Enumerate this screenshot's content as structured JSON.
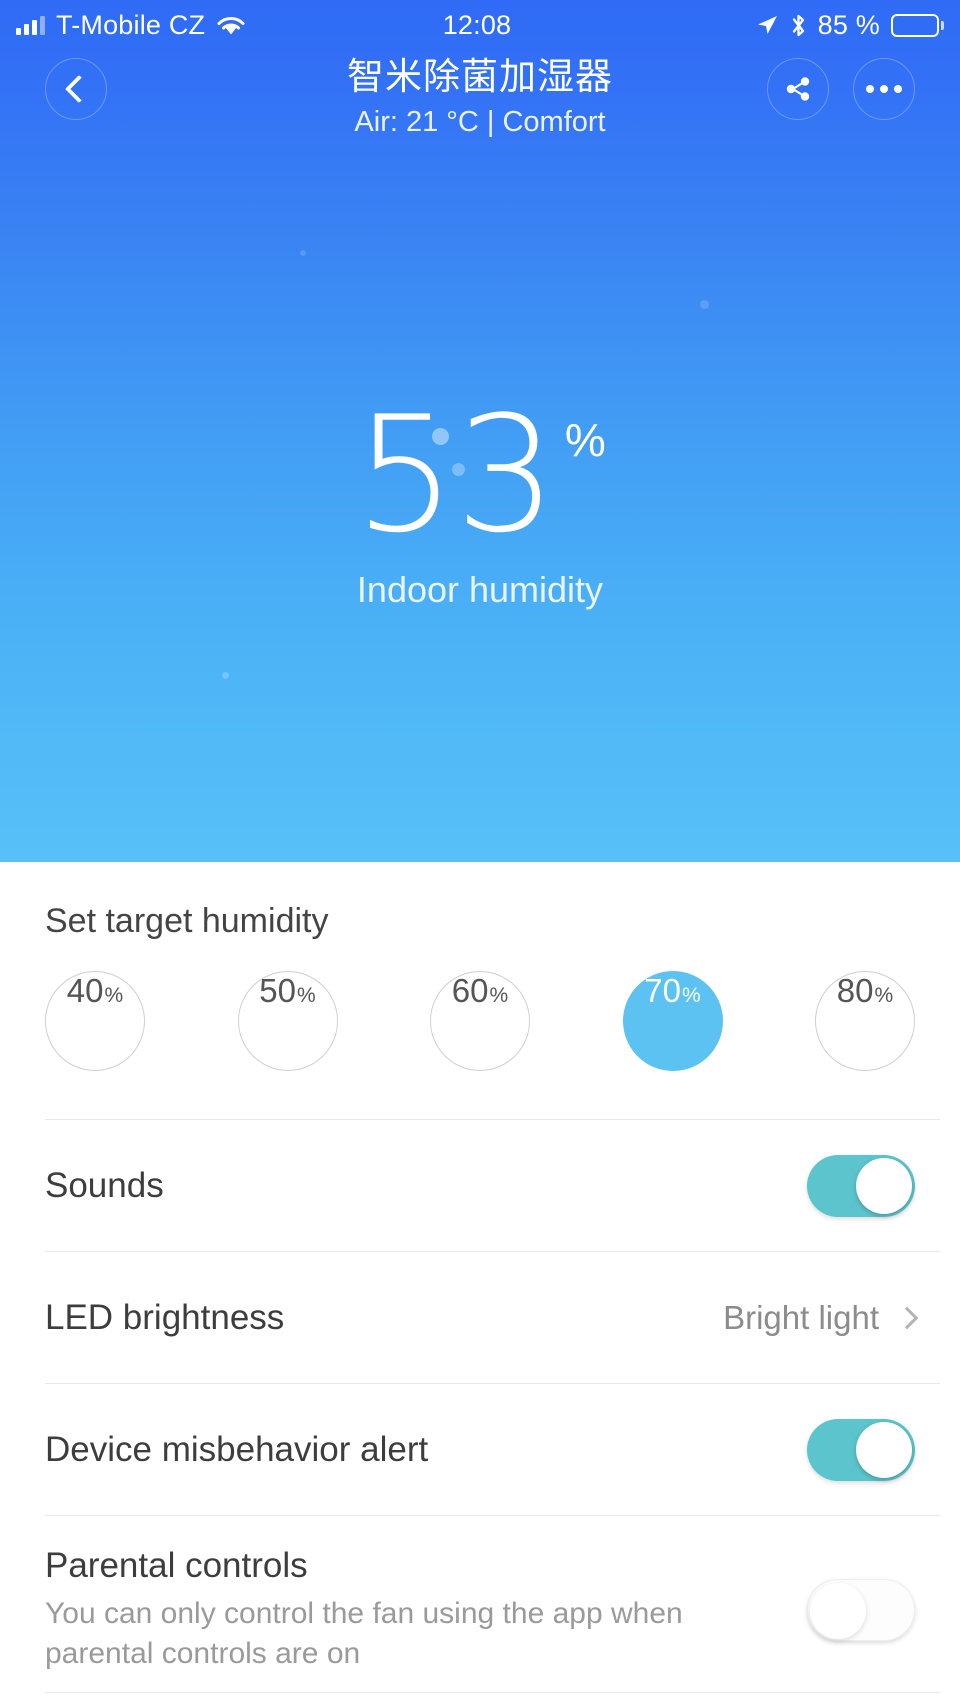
{
  "status_bar": {
    "carrier": "T-Mobile CZ",
    "time": "12:08",
    "battery_percent": "85 %",
    "icons": [
      "signal-bars-icon",
      "wifi-icon",
      "location-arrow-icon",
      "bluetooth-icon",
      "battery-icon"
    ]
  },
  "header": {
    "title": "智米除菌加湿器",
    "subtitle": "Air: 21 °C | Comfort",
    "back_icon": "chevron-left-icon",
    "share_icon": "share-icon",
    "more_icon": "ellipsis-icon"
  },
  "reading": {
    "value": "53",
    "unit": "%",
    "label": "Indoor humidity"
  },
  "target_humidity": {
    "section_title": "Set target humidity",
    "selected": "70",
    "options": [
      {
        "value": "40",
        "unit": "%",
        "selected": false
      },
      {
        "value": "50",
        "unit": "%",
        "selected": false
      },
      {
        "value": "60",
        "unit": "%",
        "selected": false
      },
      {
        "value": "70",
        "unit": "%",
        "selected": true
      },
      {
        "value": "80",
        "unit": "%",
        "selected": false
      }
    ]
  },
  "settings": {
    "sounds": {
      "label": "Sounds",
      "state": "on"
    },
    "led_brightness": {
      "label": "LED brightness",
      "value": "Bright light",
      "chevron": "chevron-right-icon"
    },
    "device_alert": {
      "label": "Device misbehavior alert",
      "state": "on"
    },
    "parental_controls": {
      "label": "Parental controls",
      "description": "You can only control the fan using the app when parental controls are on",
      "state": "off"
    }
  },
  "colors": {
    "gradient_top": "#2f6bf5",
    "gradient_bottom": "#57c0f8",
    "accent_selected": "#5cc2f2",
    "toggle_on": "#5bc4cc",
    "panel_bg": "#ffffff"
  }
}
